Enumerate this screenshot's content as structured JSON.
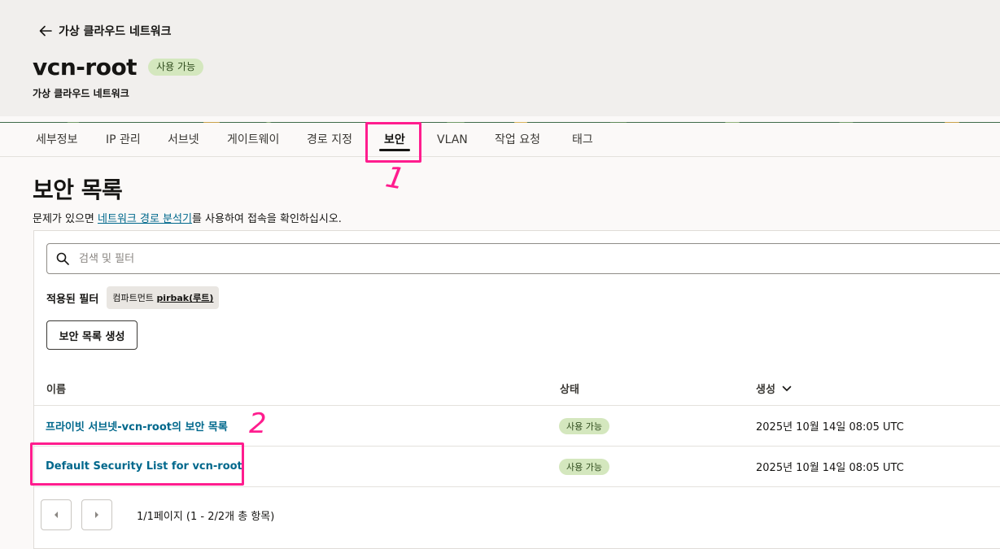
{
  "header": {
    "back_label": "가상 클라우드 네트워크",
    "title": "vcn-root",
    "status": "사용 가능",
    "subtitle": "가상 클라우드 네트워크"
  },
  "tabs": [
    {
      "label": "세부정보"
    },
    {
      "label": "IP 관리"
    },
    {
      "label": "서브넷"
    },
    {
      "label": "게이트웨이"
    },
    {
      "label": "경로 지정"
    },
    {
      "label": "보안",
      "active": true
    },
    {
      "label": "VLAN"
    },
    {
      "label": "작업 요청"
    },
    {
      "label": "태그"
    }
  ],
  "annotations": {
    "first": "1",
    "second": "2",
    "color": "#ff1d8e"
  },
  "section": {
    "title": "보안 목록",
    "hint_before": "문제가 있으면 ",
    "hint_link": "네트워크 경로 분석기",
    "hint_after": "를 사용하여 접속을 확인하십시오."
  },
  "search": {
    "placeholder": "검색 및 필터"
  },
  "filters": {
    "label": "적용된 필터",
    "chip_prefix": "컴파트먼트 ",
    "chip_value": "pirbak(루트)"
  },
  "create_button": "보안 목록 생성",
  "table": {
    "columns": {
      "name": "이름",
      "status": "상태",
      "created": "생성"
    },
    "rows": [
      {
        "name": "프라이빗 서브넷-vcn-root의 보안 목록",
        "status": "사용 가능",
        "created": "2025년 10월 14일 08:05 UTC"
      },
      {
        "name": "Default Security List for vcn-root",
        "status": "사용 가능",
        "created": "2025년 10월 14일 08:05 UTC"
      }
    ]
  },
  "pagination": {
    "text": "1/1페이지 (1 - 2/2개 총 항목)"
  },
  "colors": {
    "accent_link": "#00688c",
    "status_bg": "#d4e7be",
    "annotation": "#ff1d8e"
  }
}
